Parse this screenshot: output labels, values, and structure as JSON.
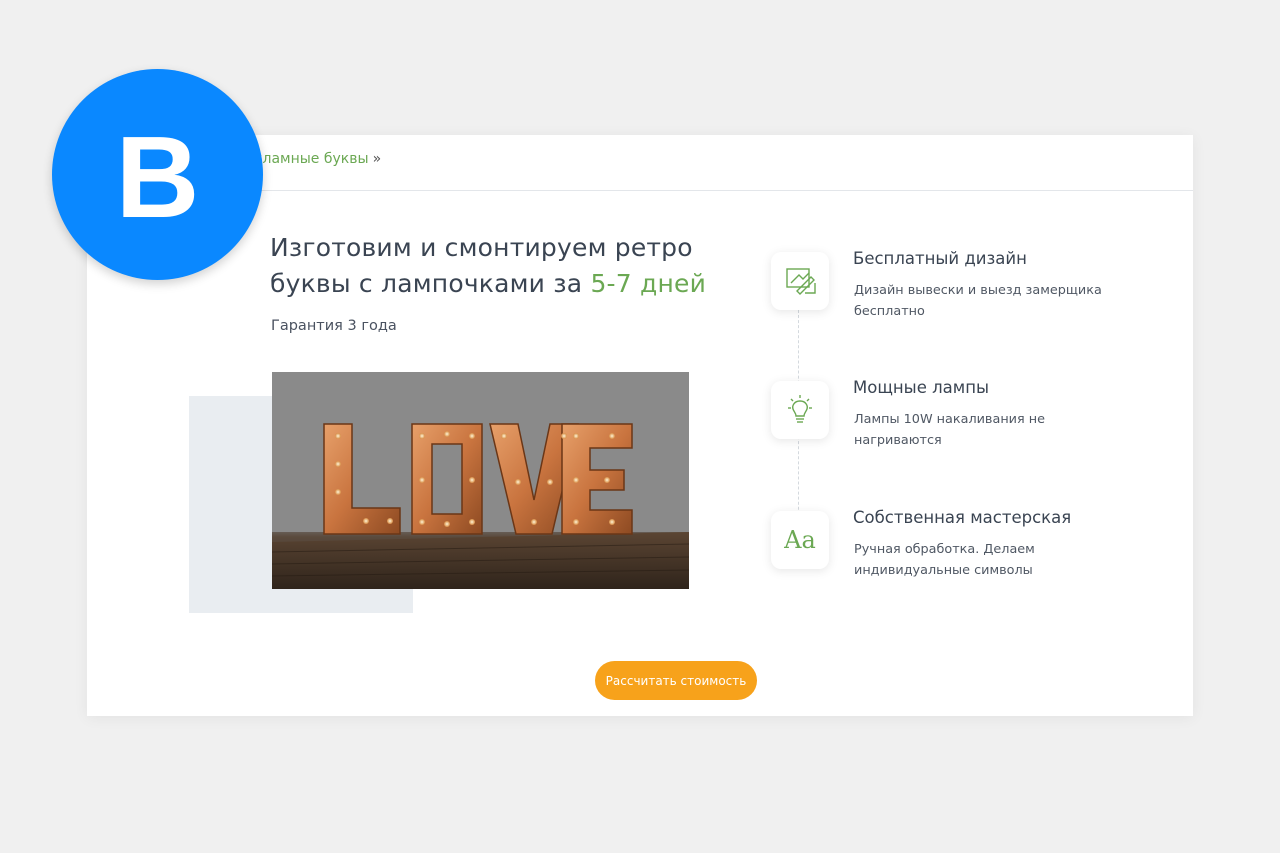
{
  "badge": {
    "letter": "В"
  },
  "breadcrumb": {
    "link": "Рекламные буквы",
    "separator": "»"
  },
  "hero": {
    "headline_main": "Изготовим и смонтируем ретро буквы с лампочками за ",
    "headline_accent": "5-7 дней",
    "subline": "Гарантия 3 года",
    "photo_word": "LOVE"
  },
  "features": [
    {
      "title": "Бесплатный дизайн",
      "desc": "Дизайн вывески и выезд замерщика бесплатно",
      "icon": "design-icon"
    },
    {
      "title": "Мощные лампы",
      "desc": "Лампы 10W накаливания не нагриваются",
      "icon": "lightbulb-icon"
    },
    {
      "title": "Собственная мастерская",
      "desc": "Ручная обработка. Делаем индивидуальные символы",
      "icon": "font-icon",
      "icon_text": "Aa"
    }
  ],
  "cta": {
    "label": "Рассчитать стоимость"
  },
  "colors": {
    "accent_green": "#6ba853",
    "cta_orange": "#f7a21b",
    "badge_blue": "#0a88ff"
  }
}
